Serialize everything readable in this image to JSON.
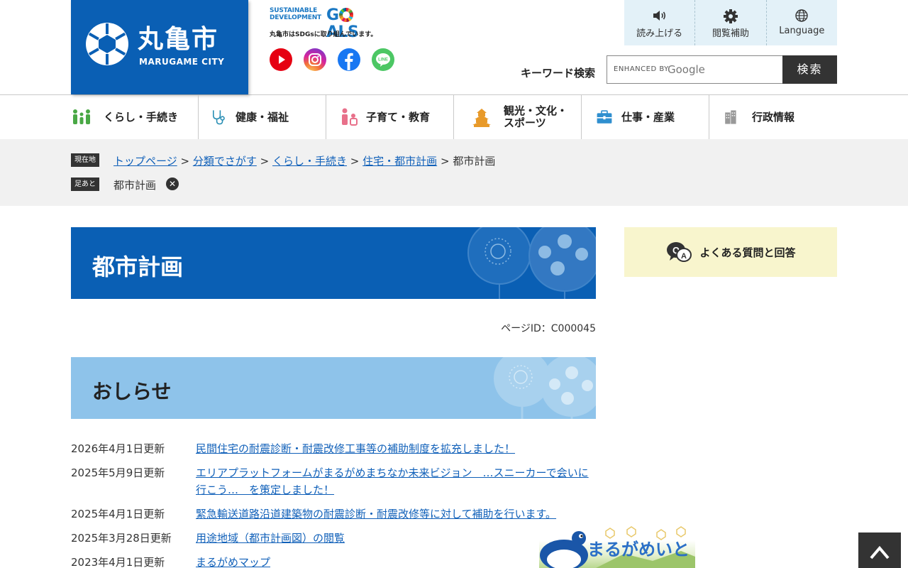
{
  "header": {
    "logo_jp": "丸亀市",
    "logo_en": "MARUGAME CITY",
    "sdgs_line1": "SUSTAINABLE",
    "sdgs_line2": "DEVELOPMENT",
    "sdgs_goals_g": "G",
    "sdgs_goals_rest": "ALS",
    "sdgs_caption": "丸亀市はSDGsに取り組んでいます。",
    "social": [
      {
        "name": "YouTube",
        "icon": "youtube-icon",
        "color": "#e60012"
      },
      {
        "name": "Instagram",
        "icon": "instagram-icon"
      },
      {
        "name": "Facebook",
        "icon": "facebook-icon",
        "color": "#1877f2"
      },
      {
        "name": "LINE",
        "icon": "line-icon",
        "color": "#4cc764",
        "label": "LINE"
      }
    ],
    "tools": [
      {
        "label": "読み上げる",
        "icon": "speaker-icon"
      },
      {
        "label": "閲覧補助",
        "icon": "gear-icon"
      },
      {
        "label": "Language",
        "icon": "globe-icon"
      }
    ],
    "search": {
      "label": "キーワード検索",
      "enhanced": "ENHANCED BY",
      "google": "Google",
      "button": "検索"
    }
  },
  "nav": [
    {
      "label": "くらし・手続き",
      "icon": "family-icon"
    },
    {
      "label": "健康・福祉",
      "icon": "stethoscope-icon"
    },
    {
      "label": "子育て・教育",
      "icon": "child-icon"
    },
    {
      "label": "観光・文化・\nスポーツ",
      "icon": "castle-icon"
    },
    {
      "label": "仕事・産業",
      "icon": "briefcase-icon"
    },
    {
      "label": "行政情報",
      "icon": "building-icon"
    }
  ],
  "breadcrumb": {
    "current_tag": "現在地",
    "links": [
      "トップページ",
      "分類でさがす",
      "くらし・手続き",
      "住宅・都市計画"
    ],
    "separator": ">",
    "current": "都市計画",
    "footprint_tag": "足あと",
    "footprint_item": "都市計画"
  },
  "main": {
    "title": "都市計画",
    "page_id": "ページID：C000045",
    "news_heading": "おしらせ",
    "news": [
      {
        "date": "2026年4月1日更新",
        "title": "民間住宅の耐震診断・耐震改修工事等の補助制度を拡充しました！"
      },
      {
        "date": "2025年5月9日更新",
        "title": "エリアプラットフォームがまるがめまちなか未来ビジョン　…スニーカーで会いに行こう…　を策定しました！"
      },
      {
        "date": "2025年4月1日更新",
        "title": "緊急輸送道路沿道建築物の耐震診断・耐震改修等に対して補助を行います。"
      },
      {
        "date": "2025年3月28日更新",
        "title": "用途地域（都市計画図）の閲覧"
      },
      {
        "date": "2023年4月1日更新",
        "title": "まるがめマップ"
      }
    ]
  },
  "side": {
    "faq_label": "よくある質問と回答",
    "banner_text": "まるがめいと"
  },
  "colors": {
    "brand_blue": "#0a5fb4",
    "news_blue": "#8ec3ea",
    "link": "#1060b9",
    "faq_bg": "#f8f5cd"
  }
}
